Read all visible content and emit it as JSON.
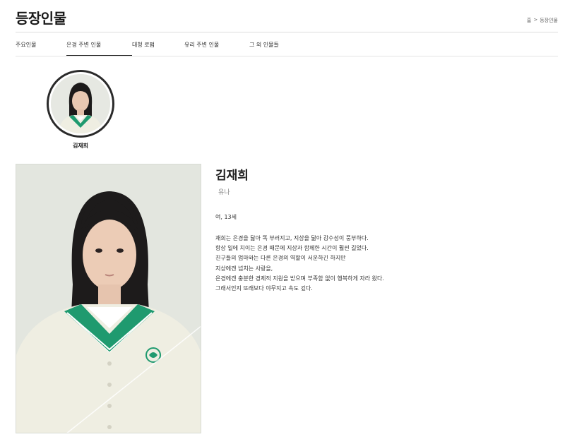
{
  "header": {
    "title": "등장인물",
    "breadcrumb": [
      "홈",
      ">",
      "등장인물"
    ]
  },
  "tabs": [
    {
      "label": "주요인물",
      "active": false
    },
    {
      "label": "은경 주변 인물",
      "active": true
    },
    {
      "label": "대청 로펌",
      "active": false
    },
    {
      "label": "유리 주변 인물",
      "active": false
    },
    {
      "label": "그 외 인물들",
      "active": false
    }
  ],
  "thumbnail": {
    "name": "김재희"
  },
  "character": {
    "name": "김재희",
    "actor": "유나",
    "meta": "여, 13세",
    "description": [
      "재희는 은경을 닮아 똑 부러지고, 지상을 닮아 감수성이 풍부하다.",
      "항상 일에 치이는 은경 때문에 지상과 함께한 시간이 훨씬 길었다.",
      "친구들의 엄마와는 다른 은경의 역할이 서운하긴 하지만",
      "지상에겐 넘치는 사랑을,",
      "은경에겐 충분한 경제적 지원을 받으며 부족함 없이 행복하게 자라 왔다.",
      "그래서인지 또래보다 야무지고 속도 깊다."
    ]
  },
  "colors": {
    "uniform_green": "#1f9a6f",
    "cardigan": "#efeee2",
    "background_photo": "#e3e6df"
  }
}
